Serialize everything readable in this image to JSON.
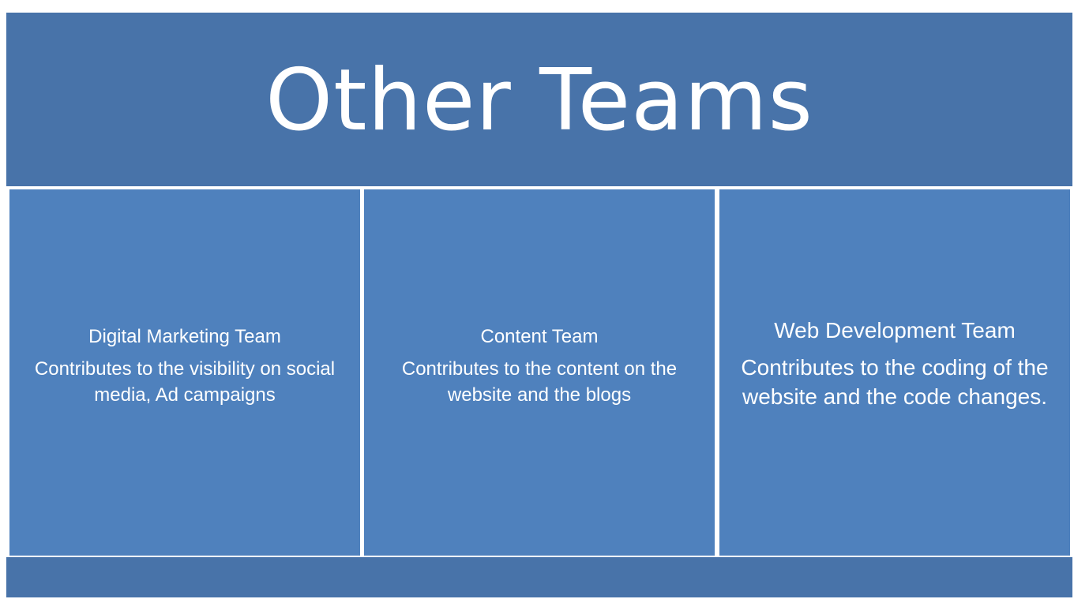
{
  "header": {
    "title": "Other Teams"
  },
  "teams": [
    {
      "name": "Digital Marketing Team",
      "description": "Contributes to the visibility on social media, Ad campaigns"
    },
    {
      "name": "Content Team",
      "description": "Contributes to the content on the website and the blogs"
    },
    {
      "name": "Web Development  Team",
      "description": "Contributes to the coding of the website and the code changes."
    }
  ],
  "colors": {
    "background": "#4873a9",
    "card": "#4f81bd",
    "text": "#ffffff",
    "divider": "#ffffff"
  }
}
